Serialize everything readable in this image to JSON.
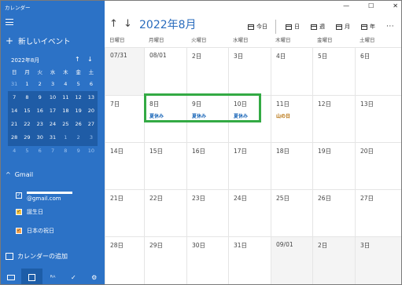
{
  "app": {
    "title": "カレンダー"
  },
  "sidebar": {
    "new_event": "新しいイベント",
    "mini_calendar": {
      "header": "2022年8月",
      "weekdays": [
        "日",
        "月",
        "火",
        "水",
        "木",
        "金",
        "土"
      ],
      "weeks": [
        [
          "31",
          "1",
          "2",
          "3",
          "4",
          "5",
          "6"
        ],
        [
          "7",
          "8",
          "9",
          "10",
          "11",
          "12",
          "13"
        ],
        [
          "14",
          "15",
          "16",
          "17",
          "18",
          "19",
          "20"
        ],
        [
          "21",
          "22",
          "23",
          "24",
          "25",
          "26",
          "27"
        ],
        [
          "28",
          "29",
          "30",
          "31",
          "1",
          "2",
          "3"
        ],
        [
          "4",
          "5",
          "6",
          "7",
          "8",
          "9",
          "10"
        ]
      ]
    },
    "account": "Gmail",
    "calendars": [
      {
        "label": "@gmail.com",
        "color": "#ffffff",
        "checked": true
      },
      {
        "label": "誕生日",
        "color": "#f5c242",
        "checked": true
      },
      {
        "label": "日本の祝日",
        "color": "#f5a24b",
        "checked": true
      }
    ],
    "add_calendar": "カレンダーの追加"
  },
  "toolbar": {
    "month_title": "2022年8月",
    "today": "今日",
    "day": "日",
    "week": "週",
    "month": "月",
    "year": "年",
    "more": "···"
  },
  "month_view": {
    "weekdays": [
      "日曜日",
      "月曜日",
      "火曜日",
      "水曜日",
      "木曜日",
      "金曜日",
      "土曜日"
    ],
    "weeks": [
      [
        {
          "d": "07/31"
        },
        {
          "d": "08/01"
        },
        {
          "d": "2日"
        },
        {
          "d": "3日"
        },
        {
          "d": "4日"
        },
        {
          "d": "5日"
        },
        {
          "d": "6日"
        }
      ],
      [
        {
          "d": "7日"
        },
        {
          "d": "8日",
          "ev": "夏休み"
        },
        {
          "d": "9日",
          "ev": "夏休み"
        },
        {
          "d": "10日",
          "ev": "夏休み"
        },
        {
          "d": "11日",
          "ev": "山の日"
        },
        {
          "d": "12日"
        },
        {
          "d": "13日"
        }
      ],
      [
        {
          "d": "14日"
        },
        {
          "d": "15日"
        },
        {
          "d": "16日"
        },
        {
          "d": "17日"
        },
        {
          "d": "18日"
        },
        {
          "d": "19日"
        },
        {
          "d": "20日"
        }
      ],
      [
        {
          "d": "21日"
        },
        {
          "d": "22日"
        },
        {
          "d": "23日"
        },
        {
          "d": "24日"
        },
        {
          "d": "25日"
        },
        {
          "d": "26日"
        },
        {
          "d": "27日"
        }
      ],
      [
        {
          "d": "28日"
        },
        {
          "d": "29日"
        },
        {
          "d": "30日"
        },
        {
          "d": "31日"
        },
        {
          "d": "09/01"
        },
        {
          "d": "2日"
        },
        {
          "d": "3日"
        }
      ]
    ]
  }
}
